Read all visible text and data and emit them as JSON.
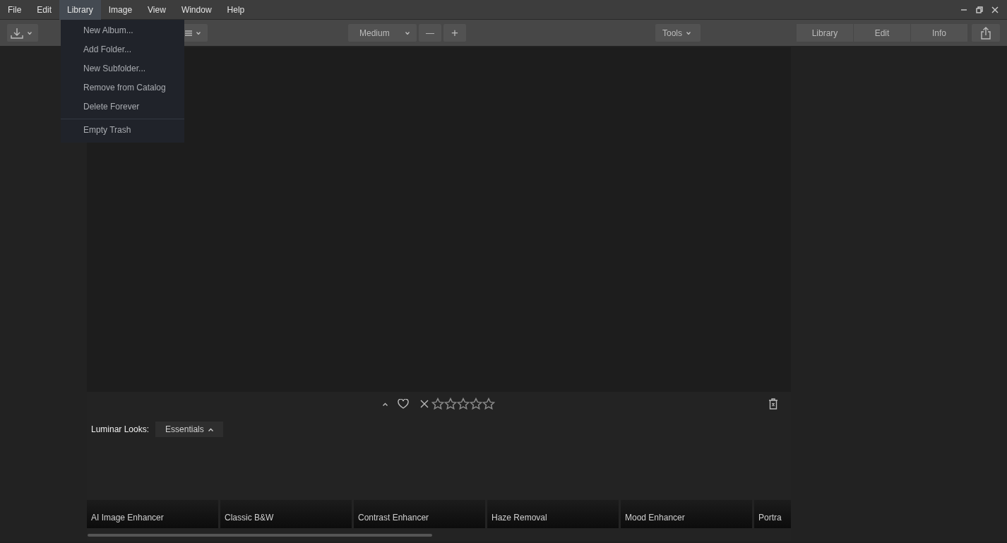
{
  "menu_bar": [
    {
      "label": "File",
      "selected": false
    },
    {
      "label": "Edit",
      "selected": false
    },
    {
      "label": "Library",
      "selected": true
    },
    {
      "label": "Image",
      "selected": false
    },
    {
      "label": "View",
      "selected": false
    },
    {
      "label": "Window",
      "selected": false
    },
    {
      "label": "Help",
      "selected": false
    }
  ],
  "library_menu": [
    {
      "label": "New Album...",
      "separator_before": false
    },
    {
      "label": "Add Folder...",
      "separator_before": false
    },
    {
      "label": "New Subfolder...",
      "separator_before": false
    },
    {
      "label": "Remove from Catalog",
      "separator_before": false
    },
    {
      "label": "Delete Forever",
      "separator_before": false
    },
    {
      "label": "Empty Trash",
      "separator_before": true
    }
  ],
  "toolbar": {
    "size_dropdown": "Medium",
    "zoom_out": "—",
    "zoom_in": "+",
    "tools_dropdown": "Tools",
    "mode_tabs": [
      "Library",
      "Edit",
      "Info"
    ]
  },
  "rating_bar": {
    "stars": 0
  },
  "looks": {
    "label": "Luminar Looks:",
    "collection": "Essentials",
    "items": [
      "AI Image Enhancer",
      "Classic B&W",
      "Contrast Enhancer",
      "Haze Removal",
      "Mood Enhancer",
      "Portra"
    ]
  }
}
